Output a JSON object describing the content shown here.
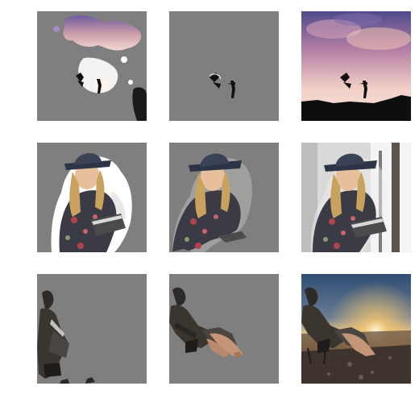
{
  "figure": {
    "background_color": "#ffffff",
    "mask_gray": "#7f7f7f",
    "rows": [
      {
        "scene": "sky-silhouette",
        "panels": [
          "masked-sky-partial",
          "masked-subject-only",
          "full-image"
        ]
      },
      {
        "scene": "woman-reading",
        "panels": [
          "masked-subject-partial",
          "masked-subject-refined",
          "full-image"
        ]
      },
      {
        "scene": "beach-sunset",
        "panels": [
          "masked-subject-partial",
          "masked-subject-refined",
          "full-image"
        ]
      }
    ]
  }
}
